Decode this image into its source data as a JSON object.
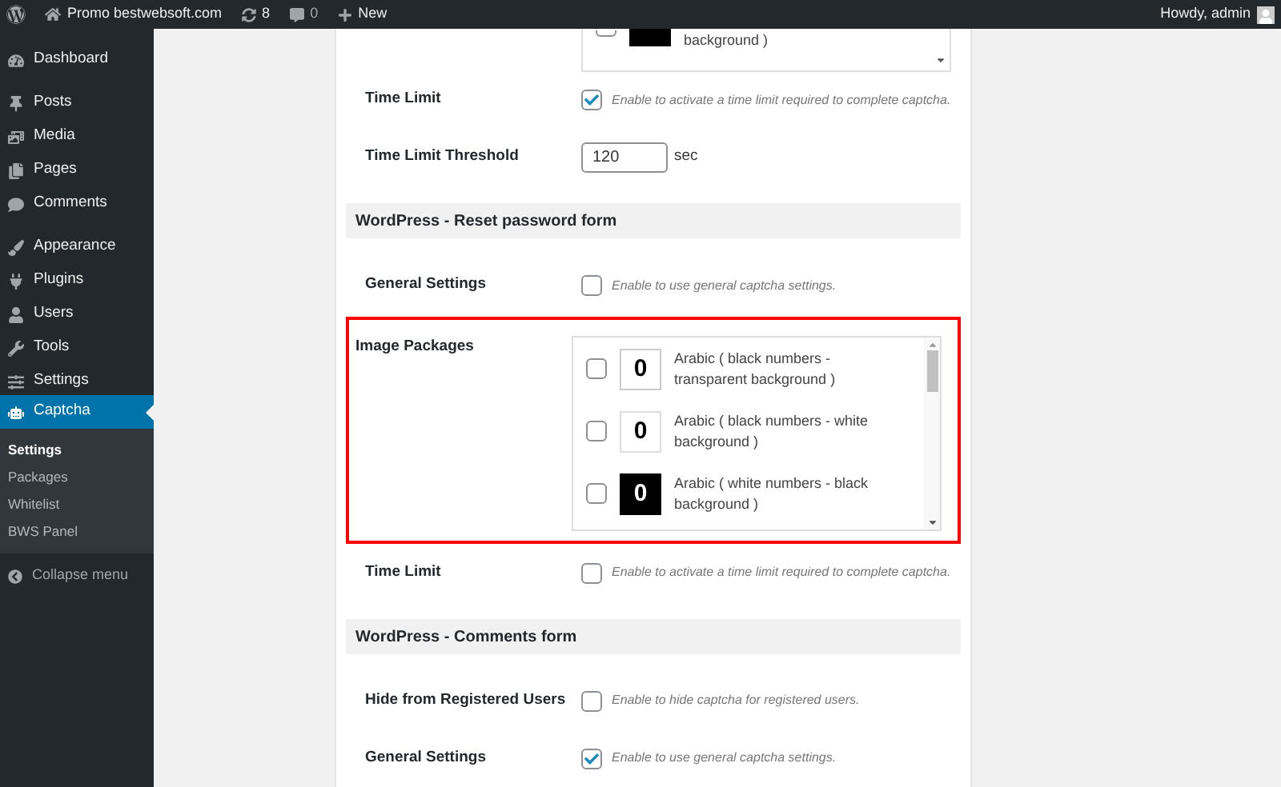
{
  "admin_bar": {
    "site": "Promo bestwebsoft.com",
    "updates": "8",
    "comments": "0",
    "new": "New",
    "greeting": "Howdy, admin"
  },
  "sidebar": {
    "groups": [
      [
        {
          "label": "Dashboard",
          "selected": false
        }
      ],
      [
        {
          "label": "Posts",
          "selected": false
        },
        {
          "label": "Media",
          "selected": false
        },
        {
          "label": "Pages",
          "selected": false
        },
        {
          "label": "Comments",
          "selected": false
        }
      ],
      [
        {
          "label": "Appearance",
          "selected": false
        },
        {
          "label": "Plugins",
          "selected": false
        },
        {
          "label": "Users",
          "selected": false
        },
        {
          "label": "Tools",
          "selected": false
        },
        {
          "label": "Settings",
          "selected": false
        },
        {
          "label": "Captcha",
          "selected": true
        }
      ]
    ],
    "submenu": [
      {
        "label": "Settings",
        "selected": true
      },
      {
        "label": "Packages",
        "selected": false
      },
      {
        "label": "Whitelist",
        "selected": false
      },
      {
        "label": "BWS Panel",
        "selected": false
      }
    ],
    "collapse": "Collapse menu"
  },
  "rows": [
    {
      "kind": "list_tail",
      "items": [
        {
          "kind": "black",
          "label": "background )",
          "checked": false
        }
      ]
    },
    {
      "kind": "checkbox",
      "label": "Time Limit",
      "checked": true,
      "description": "Enable to activate a time limit required to complete captcha."
    },
    {
      "kind": "number",
      "label": "Time Limit Threshold",
      "value": "120",
      "unit": "sec"
    },
    {
      "kind": "header",
      "label": "WordPress - Reset password form"
    },
    {
      "kind": "checkbox",
      "label": "General Settings",
      "checked": false,
      "description": "Enable to use general captcha settings."
    },
    {
      "kind": "packages",
      "label": "Image Packages",
      "highlighted": true,
      "items": [
        {
          "kind": "transparent",
          "digit": "0",
          "label": "Arabic ( black numbers - transparent background )",
          "checked": false
        },
        {
          "kind": "white",
          "digit": "0",
          "label": "Arabic ( black numbers - white background )",
          "checked": false
        },
        {
          "kind": "black",
          "digit": "0",
          "label": "Arabic ( white numbers - black background )",
          "checked": false
        }
      ]
    },
    {
      "kind": "checkbox",
      "label": "Time Limit",
      "checked": false,
      "description": "Enable to activate a time limit required to complete captcha."
    },
    {
      "kind": "header",
      "label": "WordPress - Comments form"
    },
    {
      "kind": "checkbox",
      "label": "Hide from Registered Users",
      "checked": false,
      "description": "Enable to hide captcha for registered users."
    },
    {
      "kind": "checkbox",
      "label": "General Settings",
      "checked": true,
      "description": "Enable to use general captcha settings."
    }
  ]
}
